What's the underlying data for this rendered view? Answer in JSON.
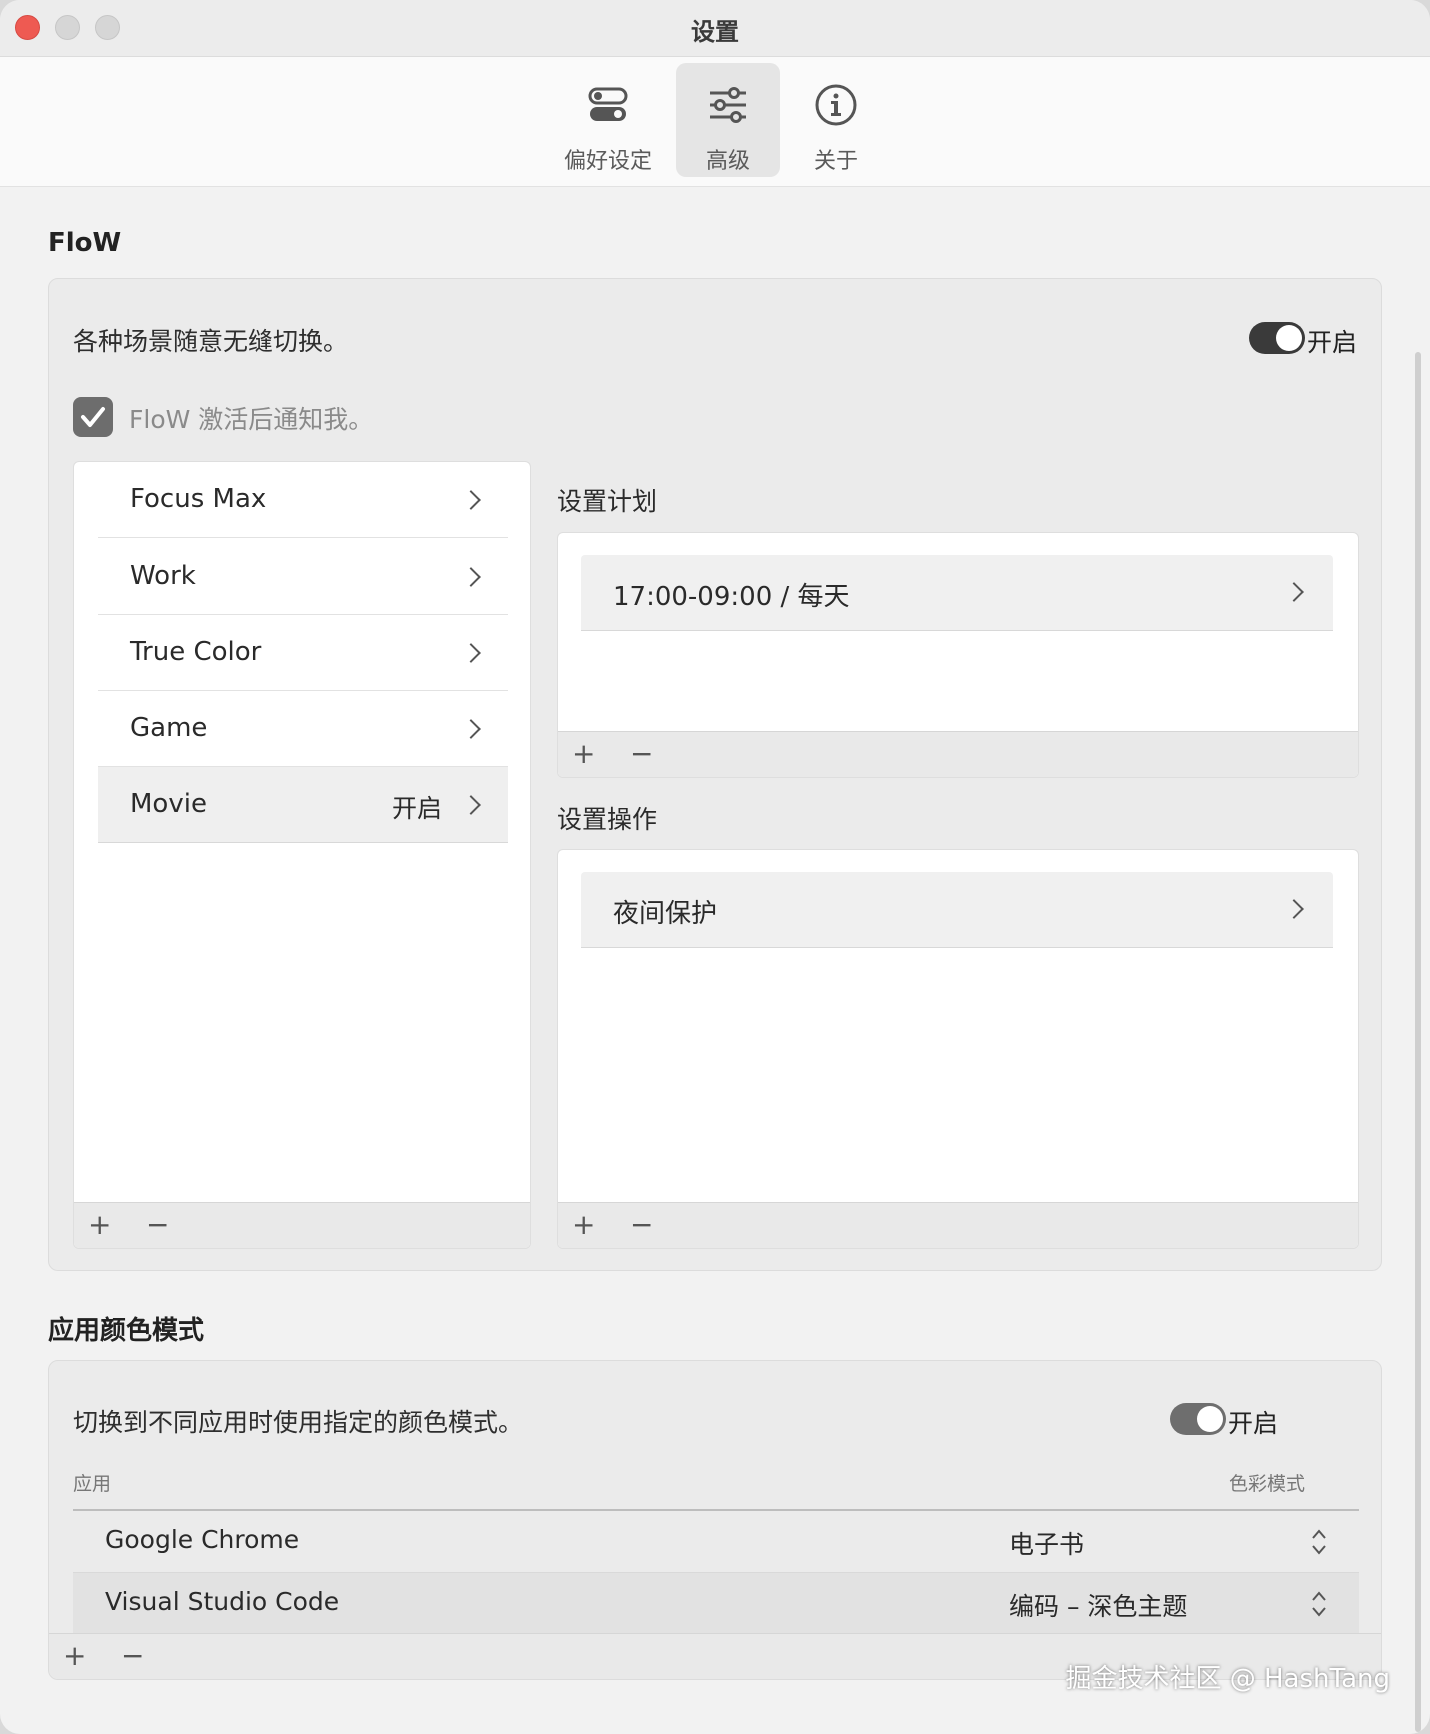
{
  "window": {
    "title": "设置"
  },
  "toolbar": {
    "tabs": [
      {
        "label": "偏好设定",
        "icon": "toggles-icon"
      },
      {
        "label": "高级",
        "icon": "sliders-icon",
        "active": true
      },
      {
        "label": "关于",
        "icon": "info-icon"
      }
    ]
  },
  "flow": {
    "title": "FloW",
    "description": "各种场景随意无缝切换。",
    "toggle_label": "开启",
    "toggle_on": true,
    "notify_label": "FloW 激活后通知我。",
    "notify_checked": true,
    "modes": [
      {
        "name": "Focus Max",
        "status": ""
      },
      {
        "name": "Work",
        "status": ""
      },
      {
        "name": "True Color",
        "status": ""
      },
      {
        "name": "Game",
        "status": ""
      },
      {
        "name": "Movie",
        "status": "开启",
        "selected": true
      }
    ],
    "plus": "+",
    "minus": "−",
    "schedule": {
      "title": "设置计划",
      "items": [
        "17:00-09:00  / 每天"
      ]
    },
    "actions": {
      "title": "设置操作",
      "items": [
        "夜间保护"
      ]
    }
  },
  "color_mode": {
    "title": "应用颜色模式",
    "description": "切换到不同应用时使用指定的颜色模式。",
    "toggle_label": "开启",
    "toggle_on": true,
    "columns": {
      "app": "应用",
      "mode": "色彩模式"
    },
    "rows": [
      {
        "app": "Google Chrome",
        "mode": "电子书"
      },
      {
        "app": "Visual Studio Code",
        "mode": "编码 – 深色主题"
      }
    ],
    "plus": "+",
    "minus": "−"
  },
  "watermark": "掘金技术社区 @ HashTang",
  "colors": {
    "close": "#ee5a52",
    "toggle_on": "#3a3a3a",
    "toggle_alt": "#6e6e6e",
    "checkbox": "#6d6d6d"
  }
}
